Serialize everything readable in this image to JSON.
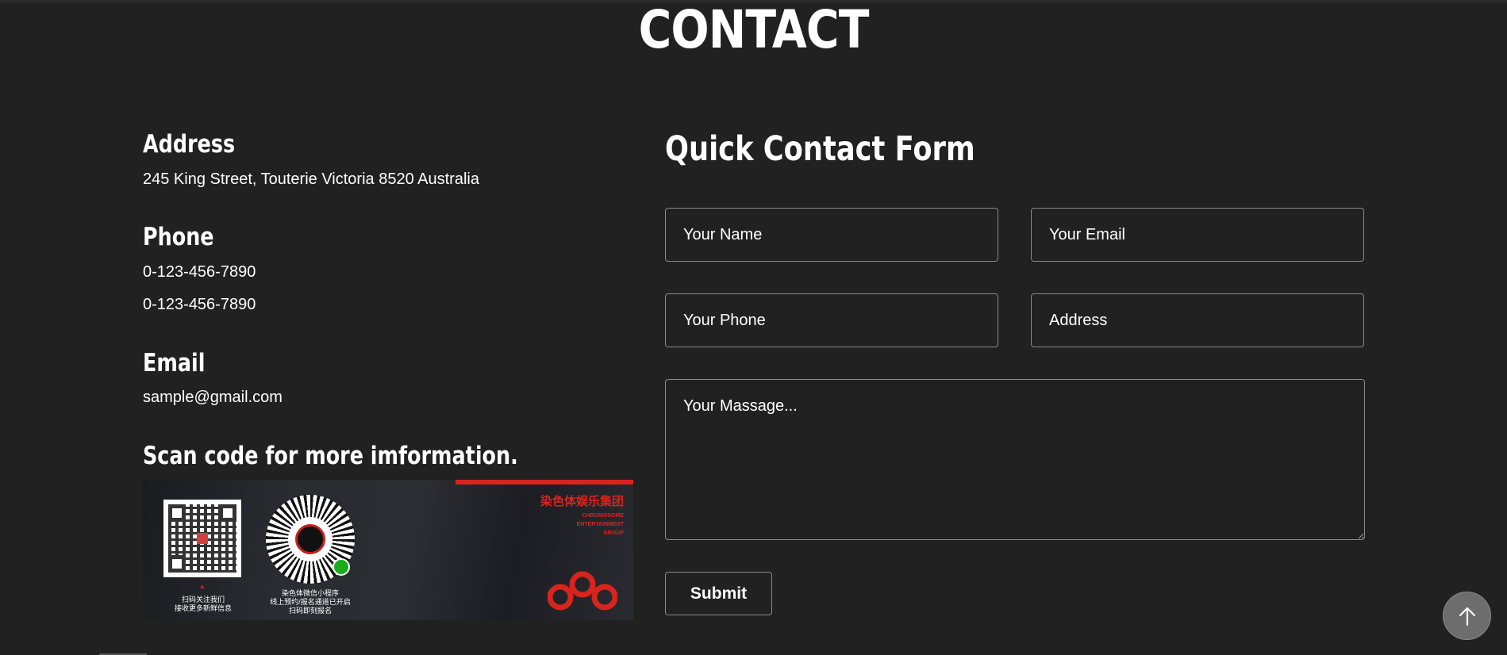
{
  "page": {
    "title": "CONTACT"
  },
  "contact_info": {
    "address": {
      "heading": "Address",
      "lines": [
        "245 King Street, Touterie Victoria 8520 Australia"
      ]
    },
    "phone": {
      "heading": "Phone",
      "lines": [
        "0-123-456-7890",
        "0-123-456-7890"
      ]
    },
    "email": {
      "heading": "Email",
      "lines": [
        "sample@gmail.com"
      ]
    },
    "scan": {
      "heading": "Scan code for more imformation.",
      "banner": {
        "qr1_caption": [
          "扫码关注我们",
          "接收更多新鲜信息"
        ],
        "qr2_caption": [
          "染色体微信小程序",
          "线上预约/报名通道已开启",
          "扫码即刻报名"
        ],
        "brand_cn": "染色体娱乐集团",
        "brand_en": [
          "CHROMOSOME",
          "ENTERTAINMENT",
          "GROUP"
        ]
      }
    }
  },
  "form": {
    "title": "Quick Contact Form",
    "name_placeholder": "Your Name",
    "email_placeholder": "Your Email",
    "phone_placeholder": "Your Phone",
    "address_placeholder": "Address",
    "message_placeholder": "Your Massage...",
    "submit_label": "Submit"
  },
  "icons": {
    "back_to_top": "arrow-up-icon"
  },
  "colors": {
    "background": "#212121",
    "text": "#ffffff",
    "accent": "#d8241f",
    "field_border": "#8a8a8a"
  }
}
